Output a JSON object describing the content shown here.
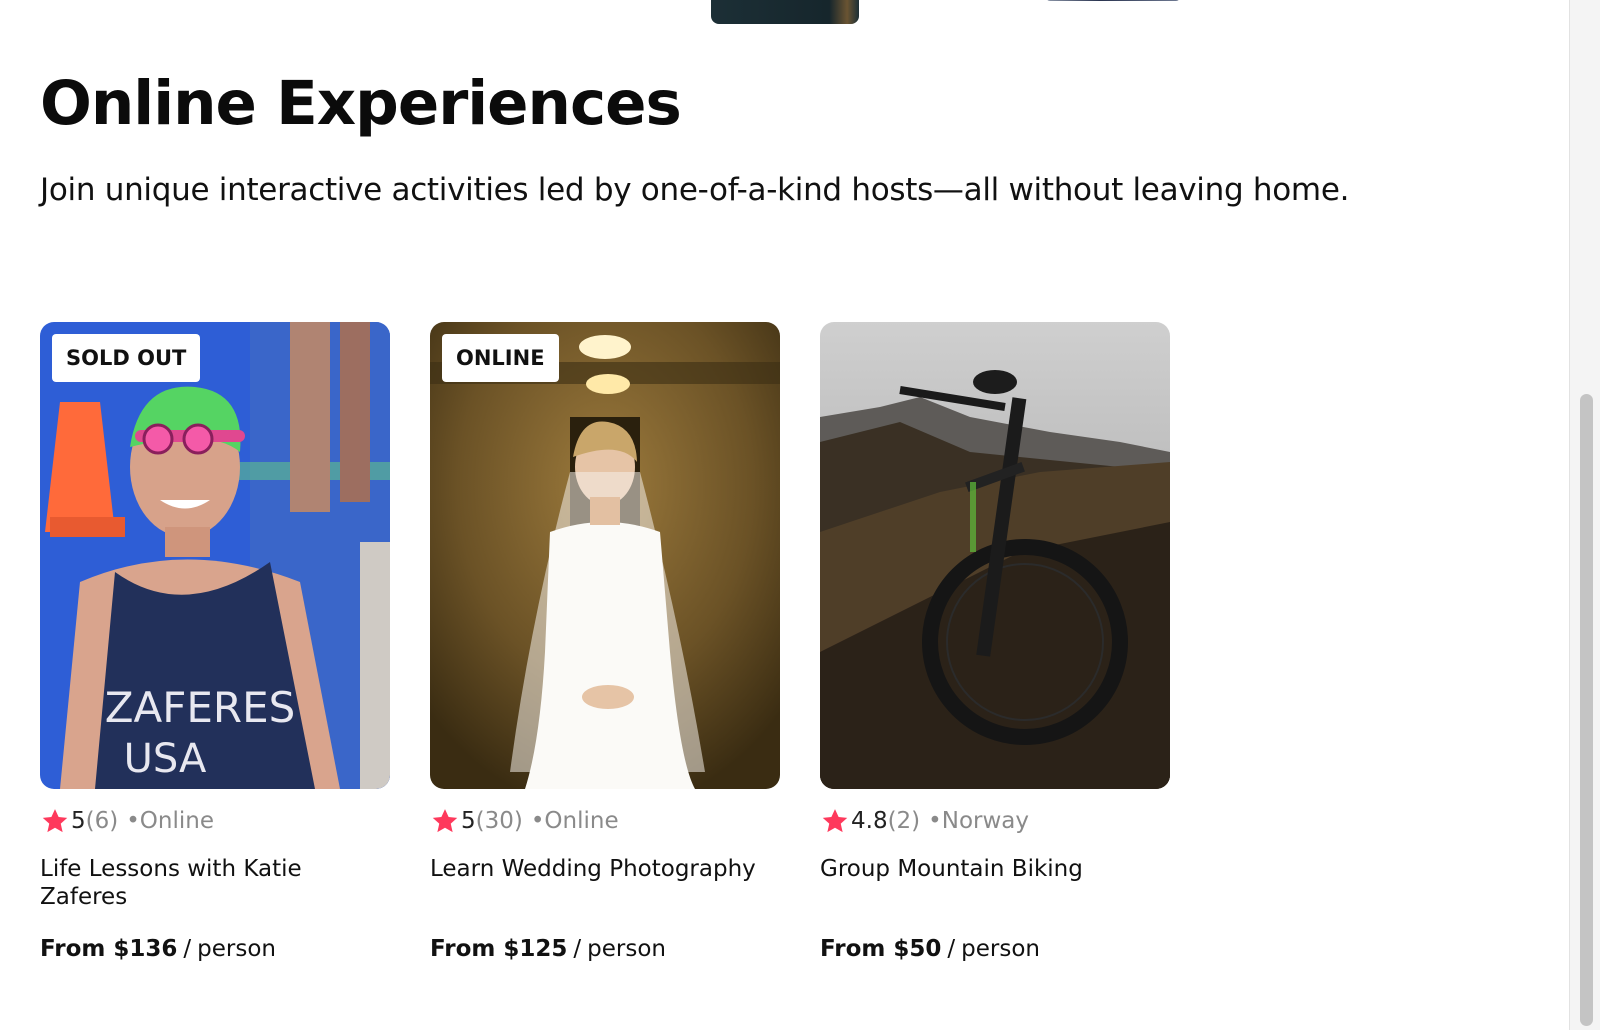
{
  "section": {
    "title": "Online Experiences",
    "subtitle": "Join unique interactive activities led by one-of-a-kind hosts—all without leaving home."
  },
  "cards": [
    {
      "badge": "SOLD OUT",
      "image": "triathlete-portrait",
      "rating": "5",
      "review_count": "(6)",
      "location": "•Online",
      "title": "Life Lessons with Katie Zaferes",
      "price": "From $136",
      "price_unit": "person"
    },
    {
      "badge": "ONLINE",
      "image": "bride-in-hallway",
      "rating": "5",
      "review_count": "(30)",
      "location": "•Online",
      "title": "Learn Wedding Photography",
      "price": "From $125",
      "price_unit": "person"
    },
    {
      "badge": "",
      "image": "mountain-bike-on-hillside",
      "rating": "4.8",
      "review_count": "(2)",
      "location": "•Norway",
      "title": "Group Mountain Biking",
      "price": "From $50",
      "price_unit": "person"
    }
  ],
  "price_separator": "/",
  "icons": {
    "rating": "star-icon"
  },
  "colors": {
    "star": "#fe395c",
    "muted_text": "#8a8a8a"
  }
}
